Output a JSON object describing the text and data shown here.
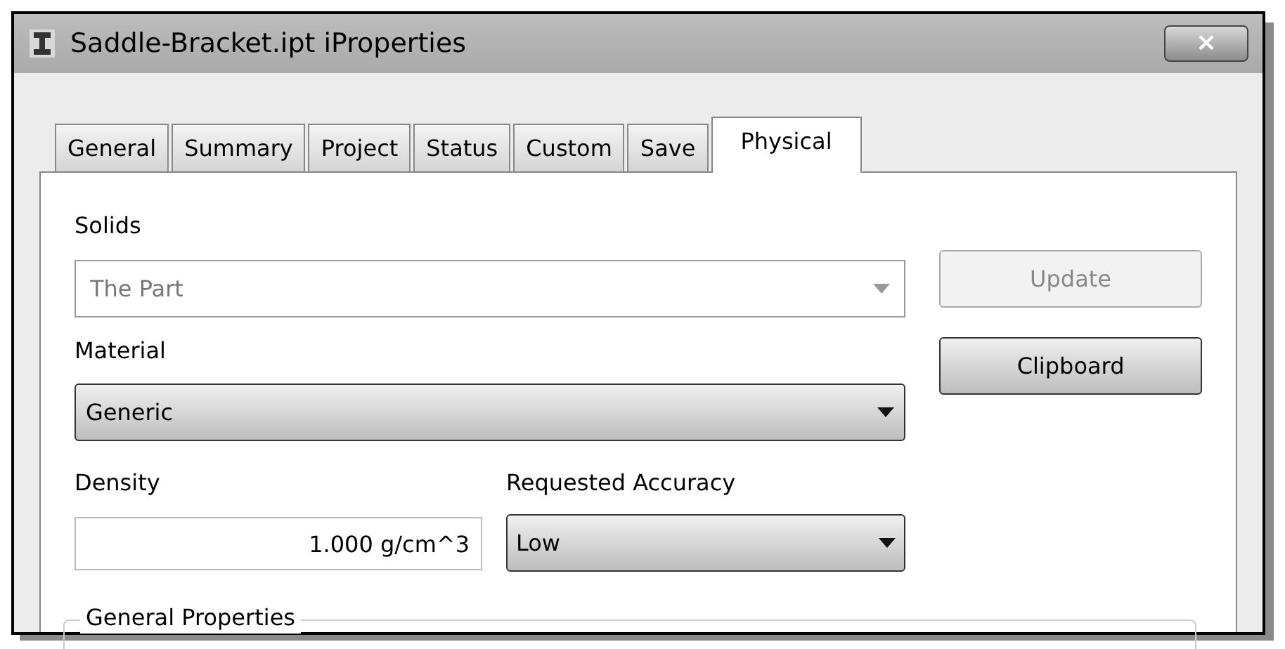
{
  "window": {
    "title": "Saddle-Bracket.ipt iProperties",
    "close": "×"
  },
  "tabs": [
    {
      "label": "General",
      "selected": false
    },
    {
      "label": "Summary",
      "selected": false
    },
    {
      "label": "Project",
      "selected": false
    },
    {
      "label": "Status",
      "selected": false
    },
    {
      "label": "Custom",
      "selected": false
    },
    {
      "label": "Save",
      "selected": false
    },
    {
      "label": "Physical",
      "selected": true
    }
  ],
  "solids": {
    "label": "Solids",
    "value": "The Part",
    "disabled": true
  },
  "buttons": [
    {
      "label": "Update",
      "disabled": true
    },
    {
      "label": "Clipboard",
      "disabled": false
    }
  ],
  "material": {
    "label": "Material",
    "value": "Generic"
  },
  "density": {
    "label": "Density",
    "value": "1.000 g/cm^3"
  },
  "accuracy": {
    "label": "Requested Accuracy",
    "value": "Low"
  },
  "group": {
    "label": "General Properties"
  }
}
